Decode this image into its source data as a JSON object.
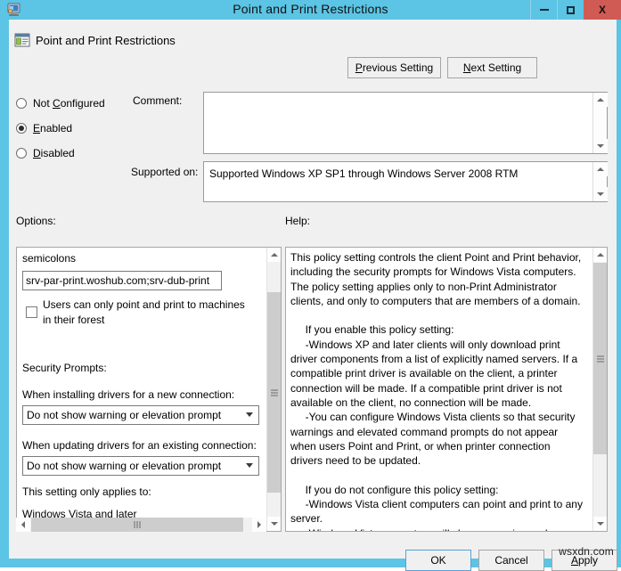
{
  "window": {
    "title": "Point and Print Restrictions",
    "icon": "computer-policy-icon",
    "minimize_label": "Minimize",
    "maximize_label": "Maximize",
    "close_label": "X"
  },
  "header": {
    "icon": "policy-setting-icon",
    "title": "Point and Print Restrictions",
    "previous_setting": "Previous Setting",
    "previous_accesskey": "P",
    "next_setting": "Next Setting",
    "next_accesskey": "N"
  },
  "state": {
    "options": [
      {
        "label": "Not Configured",
        "accesskey": "C",
        "selected": false
      },
      {
        "label": "Enabled",
        "accesskey": "E",
        "selected": true
      },
      {
        "label": "Disabled",
        "accesskey": "D",
        "selected": false
      }
    ]
  },
  "comment": {
    "label": "Comment:",
    "value": ""
  },
  "supported_on": {
    "label": "Supported on:",
    "value": "Supported Windows XP SP1 through Windows Server 2008 RTM"
  },
  "panels": {
    "options_label": "Options:",
    "help_label": "Help:"
  },
  "options_panel": {
    "semicolons_text": "semicolons",
    "servers_input": "srv-par-print.woshub.com;srv-dub-print",
    "forest_checkbox": {
      "label": "Users can only point and print to machines in their forest",
      "checked": false
    },
    "security_prompts_label": "Security Prompts:",
    "installing_label": "When installing drivers for a new connection:",
    "installing_value": "Do not show warning or elevation prompt",
    "updating_label": "When updating drivers for an existing connection:",
    "updating_value": "Do not show warning or elevation prompt",
    "applies_to_label": "This setting only applies to:",
    "applies_to_value": "Windows Vista and later"
  },
  "help_panel": {
    "text": "This policy setting controls the client Point and Print behavior, including the security prompts for Windows Vista computers. The policy setting applies only to non-Print Administrator clients, and only to computers that are members of a domain.\n\n     If you enable this policy setting:\n     -Windows XP and later clients will only download print driver components from a list of explicitly named servers. If a compatible print driver is available on the client, a printer connection will be made. If a compatible print driver is not available on the client, no connection will be made.\n     -You can configure Windows Vista clients so that security warnings and elevated command prompts do not appear when users Point and Print, or when printer connection drivers need to be updated.\n\n     If you do not configure this policy setting:\n     -Windows Vista client computers can point and print to any server.\n     -Windows Vista computers will show a warning and an elevated command prompt when users create a printer"
  },
  "footer": {
    "ok": "OK",
    "cancel": "Cancel",
    "apply": "Apply",
    "apply_accesskey": "A",
    "watermark": "wsxdn.com"
  },
  "colors": {
    "frame": "#5cc4e4",
    "close_button": "#d05b55",
    "client_bg": "#f0f0f0",
    "field_bg": "#ffffff",
    "focus_border": "#5a9fd4"
  }
}
